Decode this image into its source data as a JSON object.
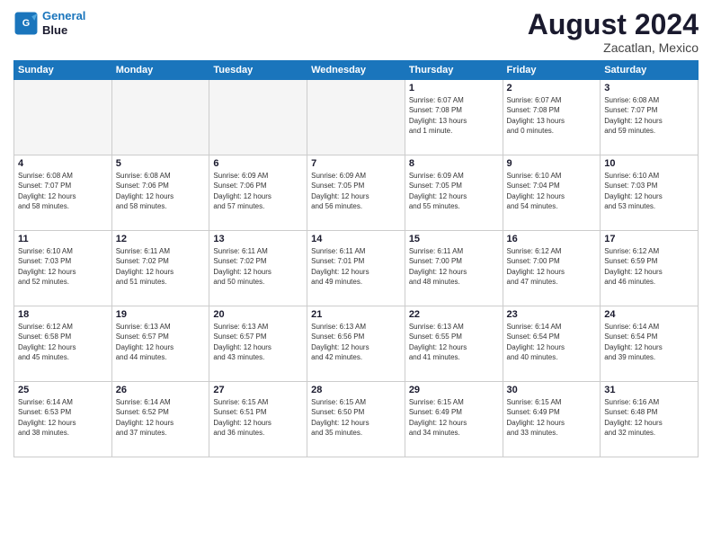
{
  "logo": {
    "line1": "General",
    "line2": "Blue"
  },
  "title": "August 2024",
  "location": "Zacatlan, Mexico",
  "headers": [
    "Sunday",
    "Monday",
    "Tuesday",
    "Wednesday",
    "Thursday",
    "Friday",
    "Saturday"
  ],
  "weeks": [
    [
      {
        "day": "",
        "info": ""
      },
      {
        "day": "",
        "info": ""
      },
      {
        "day": "",
        "info": ""
      },
      {
        "day": "",
        "info": ""
      },
      {
        "day": "1",
        "info": "Sunrise: 6:07 AM\nSunset: 7:08 PM\nDaylight: 13 hours\nand 1 minute."
      },
      {
        "day": "2",
        "info": "Sunrise: 6:07 AM\nSunset: 7:08 PM\nDaylight: 13 hours\nand 0 minutes."
      },
      {
        "day": "3",
        "info": "Sunrise: 6:08 AM\nSunset: 7:07 PM\nDaylight: 12 hours\nand 59 minutes."
      }
    ],
    [
      {
        "day": "4",
        "info": "Sunrise: 6:08 AM\nSunset: 7:07 PM\nDaylight: 12 hours\nand 58 minutes."
      },
      {
        "day": "5",
        "info": "Sunrise: 6:08 AM\nSunset: 7:06 PM\nDaylight: 12 hours\nand 58 minutes."
      },
      {
        "day": "6",
        "info": "Sunrise: 6:09 AM\nSunset: 7:06 PM\nDaylight: 12 hours\nand 57 minutes."
      },
      {
        "day": "7",
        "info": "Sunrise: 6:09 AM\nSunset: 7:05 PM\nDaylight: 12 hours\nand 56 minutes."
      },
      {
        "day": "8",
        "info": "Sunrise: 6:09 AM\nSunset: 7:05 PM\nDaylight: 12 hours\nand 55 minutes."
      },
      {
        "day": "9",
        "info": "Sunrise: 6:10 AM\nSunset: 7:04 PM\nDaylight: 12 hours\nand 54 minutes."
      },
      {
        "day": "10",
        "info": "Sunrise: 6:10 AM\nSunset: 7:03 PM\nDaylight: 12 hours\nand 53 minutes."
      }
    ],
    [
      {
        "day": "11",
        "info": "Sunrise: 6:10 AM\nSunset: 7:03 PM\nDaylight: 12 hours\nand 52 minutes."
      },
      {
        "day": "12",
        "info": "Sunrise: 6:11 AM\nSunset: 7:02 PM\nDaylight: 12 hours\nand 51 minutes."
      },
      {
        "day": "13",
        "info": "Sunrise: 6:11 AM\nSunset: 7:02 PM\nDaylight: 12 hours\nand 50 minutes."
      },
      {
        "day": "14",
        "info": "Sunrise: 6:11 AM\nSunset: 7:01 PM\nDaylight: 12 hours\nand 49 minutes."
      },
      {
        "day": "15",
        "info": "Sunrise: 6:11 AM\nSunset: 7:00 PM\nDaylight: 12 hours\nand 48 minutes."
      },
      {
        "day": "16",
        "info": "Sunrise: 6:12 AM\nSunset: 7:00 PM\nDaylight: 12 hours\nand 47 minutes."
      },
      {
        "day": "17",
        "info": "Sunrise: 6:12 AM\nSunset: 6:59 PM\nDaylight: 12 hours\nand 46 minutes."
      }
    ],
    [
      {
        "day": "18",
        "info": "Sunrise: 6:12 AM\nSunset: 6:58 PM\nDaylight: 12 hours\nand 45 minutes."
      },
      {
        "day": "19",
        "info": "Sunrise: 6:13 AM\nSunset: 6:57 PM\nDaylight: 12 hours\nand 44 minutes."
      },
      {
        "day": "20",
        "info": "Sunrise: 6:13 AM\nSunset: 6:57 PM\nDaylight: 12 hours\nand 43 minutes."
      },
      {
        "day": "21",
        "info": "Sunrise: 6:13 AM\nSunset: 6:56 PM\nDaylight: 12 hours\nand 42 minutes."
      },
      {
        "day": "22",
        "info": "Sunrise: 6:13 AM\nSunset: 6:55 PM\nDaylight: 12 hours\nand 41 minutes."
      },
      {
        "day": "23",
        "info": "Sunrise: 6:14 AM\nSunset: 6:54 PM\nDaylight: 12 hours\nand 40 minutes."
      },
      {
        "day": "24",
        "info": "Sunrise: 6:14 AM\nSunset: 6:54 PM\nDaylight: 12 hours\nand 39 minutes."
      }
    ],
    [
      {
        "day": "25",
        "info": "Sunrise: 6:14 AM\nSunset: 6:53 PM\nDaylight: 12 hours\nand 38 minutes."
      },
      {
        "day": "26",
        "info": "Sunrise: 6:14 AM\nSunset: 6:52 PM\nDaylight: 12 hours\nand 37 minutes."
      },
      {
        "day": "27",
        "info": "Sunrise: 6:15 AM\nSunset: 6:51 PM\nDaylight: 12 hours\nand 36 minutes."
      },
      {
        "day": "28",
        "info": "Sunrise: 6:15 AM\nSunset: 6:50 PM\nDaylight: 12 hours\nand 35 minutes."
      },
      {
        "day": "29",
        "info": "Sunrise: 6:15 AM\nSunset: 6:49 PM\nDaylight: 12 hours\nand 34 minutes."
      },
      {
        "day": "30",
        "info": "Sunrise: 6:15 AM\nSunset: 6:49 PM\nDaylight: 12 hours\nand 33 minutes."
      },
      {
        "day": "31",
        "info": "Sunrise: 6:16 AM\nSunset: 6:48 PM\nDaylight: 12 hours\nand 32 minutes."
      }
    ]
  ]
}
